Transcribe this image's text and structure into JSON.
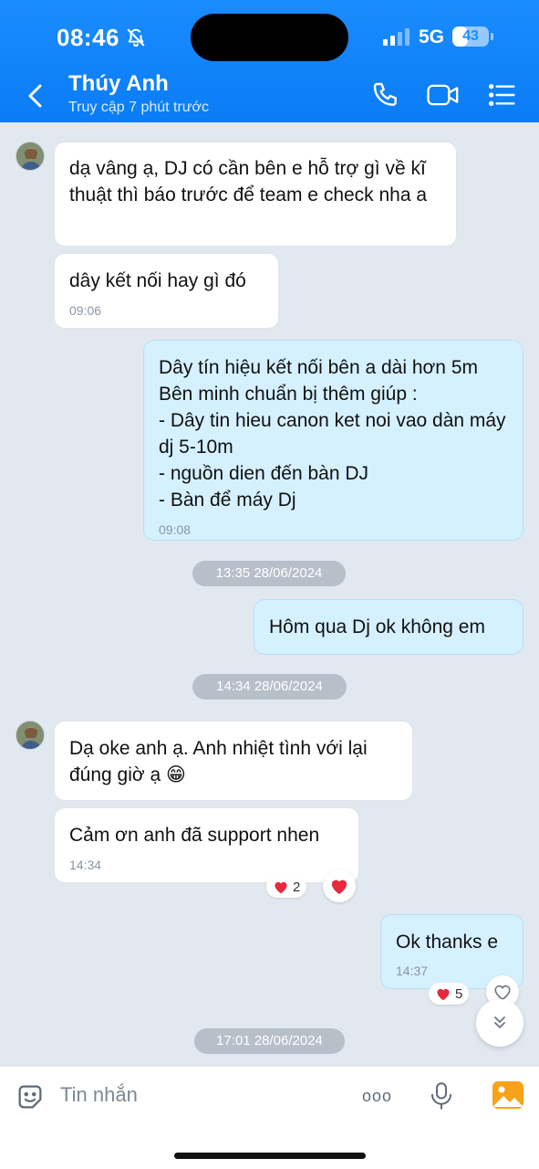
{
  "status_bar": {
    "time": "08:46",
    "network": "5G",
    "battery": "43",
    "battery_level": 0.43
  },
  "header": {
    "contact_name": "Thúy Anh",
    "contact_status": "Truy cập 7 phút trước",
    "icons": [
      "back-arrow-icon",
      "phone-icon",
      "video-call-icon",
      "menu-list-icon"
    ]
  },
  "messages": [
    {
      "id": "m1",
      "direction": "in",
      "text": "dạ vâng ạ, DJ có cần bên e hỗ trợ gì về kĩ thuật thì báo trước để team e check nha a"
    },
    {
      "id": "m2",
      "direction": "in",
      "text": "dây kết nối hay gì đó",
      "time": "09:06"
    },
    {
      "id": "m3",
      "direction": "out",
      "lines": [
        "Dây tín hiệu kết nối bên a dài hơn 5m",
        "Bên minh chuẩn bị thêm giúp :",
        "- Dây tin hieu canon ket noi vao dàn máy dj 5-10m",
        "- nguồn dien đến bàn DJ",
        "- Bàn để máy Dj"
      ],
      "time": "09:08"
    },
    {
      "id": "d1",
      "date_separator": "13:35 28/06/2024"
    },
    {
      "id": "m4",
      "direction": "out",
      "text": "Hôm qua Dj ok không em"
    },
    {
      "id": "d2",
      "date_separator": "14:34 28/06/2024"
    },
    {
      "id": "m5",
      "direction": "in",
      "text": "Dạ oke anh ạ. Anh nhiệt tình với lại đúng giờ ạ",
      "emoji": "😁"
    },
    {
      "id": "m6",
      "direction": "in",
      "text": "Cảm ơn anh đã support nhen",
      "time": "14:34",
      "reaction_count": "2"
    },
    {
      "id": "m7",
      "direction": "out",
      "text": "Ok thanks e",
      "time": "14:37",
      "reaction_count": "5"
    },
    {
      "id": "d3",
      "date_separator": "17:01 28/06/2024"
    }
  ],
  "input_bar": {
    "placeholder": "Tin nhắn",
    "more_label": "ooo"
  },
  "colors": {
    "header_blue": "#0a7cf5",
    "outgoing_bubble": "#d5f0ff",
    "incoming_bubble": "#ffffff",
    "chat_background": "#e2e8f0",
    "heart": "#e8283d"
  }
}
